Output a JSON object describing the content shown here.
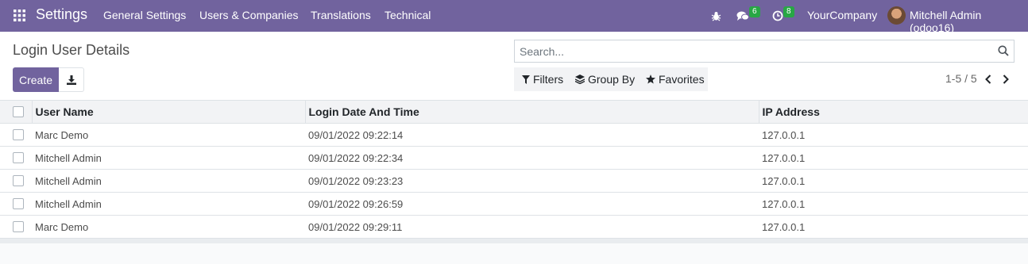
{
  "navbar": {
    "app_name": "Settings",
    "menu": [
      "General Settings",
      "Users & Companies",
      "Translations",
      "Technical"
    ],
    "messages_count": "6",
    "activities_count": "8",
    "company": "YourCompany",
    "user": "Mitchell Admin (odoo16)",
    "colors": {
      "navbar_bg": "#71639e",
      "badge": "#28a745"
    },
    "icons": [
      "apps-grid-icon",
      "bug-icon",
      "chat-icon",
      "clock-icon",
      "avatar"
    ]
  },
  "control_panel": {
    "title": "Login User Details",
    "create_label": "Create",
    "search_placeholder": "Search...",
    "filters_label": "Filters",
    "group_by_label": "Group By",
    "favorites_label": "Favorites",
    "pager": "1-5 / 5"
  },
  "table": {
    "columns": [
      "User Name",
      "Login Date And Time",
      "IP Address"
    ],
    "rows": [
      [
        "Marc Demo",
        "09/01/2022 09:22:14",
        "127.0.0.1"
      ],
      [
        "Mitchell Admin",
        "09/01/2022 09:22:34",
        "127.0.0.1"
      ],
      [
        "Mitchell Admin",
        "09/01/2022 09:23:23",
        "127.0.0.1"
      ],
      [
        "Mitchell Admin",
        "09/01/2022 09:26:59",
        "127.0.0.1"
      ],
      [
        "Marc Demo",
        "09/01/2022 09:29:11",
        "127.0.0.1"
      ]
    ]
  }
}
